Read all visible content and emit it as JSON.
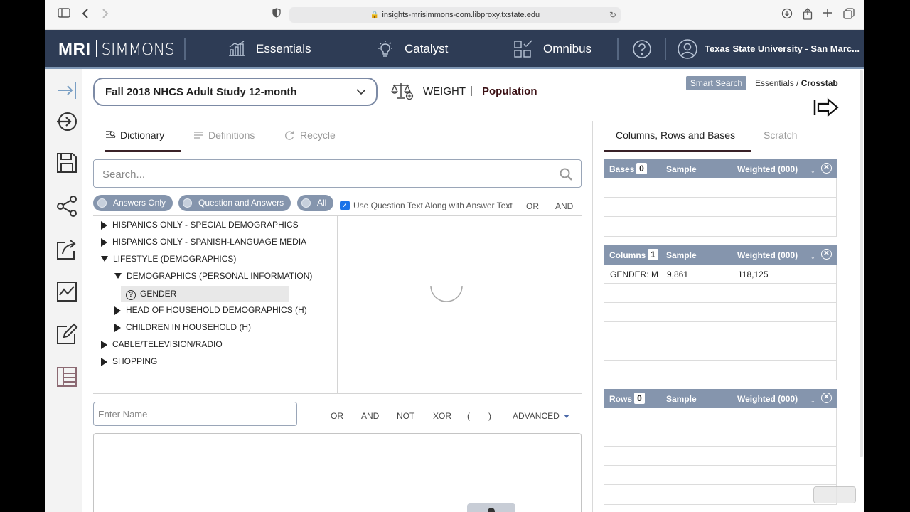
{
  "browser": {
    "url": "insights-mrisimmons-com.libproxy.txstate.edu"
  },
  "app": {
    "logo_bold": "MRI",
    "logo_light": "SIMMONS",
    "nav": [
      {
        "label": "Essentials",
        "icon": "bar-chart-icon"
      },
      {
        "label": "Catalyst",
        "icon": "lightbulb-icon"
      },
      {
        "label": "Omnibus",
        "icon": "grid-check-icon"
      }
    ],
    "user": "Texas State University - San Marc..."
  },
  "study": {
    "name": "Fall 2018 NHCS Adult Study 12-month",
    "weight_label": "WEIGHT",
    "separator": "|",
    "weight_value": "Population"
  },
  "top_right": {
    "smart_search": "Smart Search",
    "breadcrumb_parent": "Essentials",
    "breadcrumb_sep": " / ",
    "breadcrumb_current": "Crosstab"
  },
  "tabs": [
    {
      "label": "Dictionary",
      "active": true
    },
    {
      "label": "Definitions",
      "active": false
    },
    {
      "label": "Recycle",
      "active": false
    }
  ],
  "search": {
    "placeholder": "Search..."
  },
  "filters": {
    "answers_only": "Answers Only",
    "question_and_answers": "Question and Answers",
    "all": "All",
    "use_question_text": "Use Question Text Along with Answer Text",
    "or": "OR",
    "and": "AND"
  },
  "tree": [
    {
      "label": "HISPANICS ONLY - SPECIAL DEMOGRAPHICS",
      "level": 0,
      "state": "collapsed"
    },
    {
      "label": "HISPANICS ONLY - SPANISH-LANGUAGE MEDIA",
      "level": 0,
      "state": "collapsed"
    },
    {
      "label": "LIFESTYLE (DEMOGRAPHICS)",
      "level": 0,
      "state": "expanded"
    },
    {
      "label": "DEMOGRAPHICS (PERSONAL INFORMATION)",
      "level": 1,
      "state": "expanded"
    },
    {
      "label": "GENDER",
      "level": 2,
      "state": "question"
    },
    {
      "label": "HEAD OF HOUSEHOLD DEMOGRAPHICS (H)",
      "level": 1,
      "state": "collapsed"
    },
    {
      "label": "CHILDREN IN HOUSEHOLD (H)",
      "level": 1,
      "state": "collapsed"
    },
    {
      "label": "CABLE/TELEVISION/RADIO",
      "level": 0,
      "state": "collapsed"
    },
    {
      "label": "SHOPPING",
      "level": 0,
      "state": "collapsed"
    }
  ],
  "expression": {
    "name_placeholder": "Enter Name",
    "ops": [
      "OR",
      "AND",
      "NOT",
      "XOR",
      "(",
      ")"
    ],
    "advanced": "ADVANCED"
  },
  "right_tabs": [
    {
      "label": "Columns, Rows and Bases",
      "active": true
    },
    {
      "label": "Scratch",
      "active": false
    }
  ],
  "bases": {
    "title": "Bases",
    "count": "0",
    "sample": "Sample",
    "weighted": "Weighted (000)"
  },
  "columns": {
    "title": "Columns",
    "count": "1",
    "sample": "Sample",
    "weighted": "Weighted (000)",
    "rows": [
      {
        "name": "GENDER: M",
        "sample": "9,861",
        "weighted": "118,125"
      }
    ]
  },
  "rows_box": {
    "title": "Rows",
    "count": "0",
    "sample": "Sample",
    "weighted": "Weighted (000)"
  },
  "colors": {
    "header_bg": "#2e3c55",
    "accent": "#8595ad",
    "population": "#3b1014"
  }
}
